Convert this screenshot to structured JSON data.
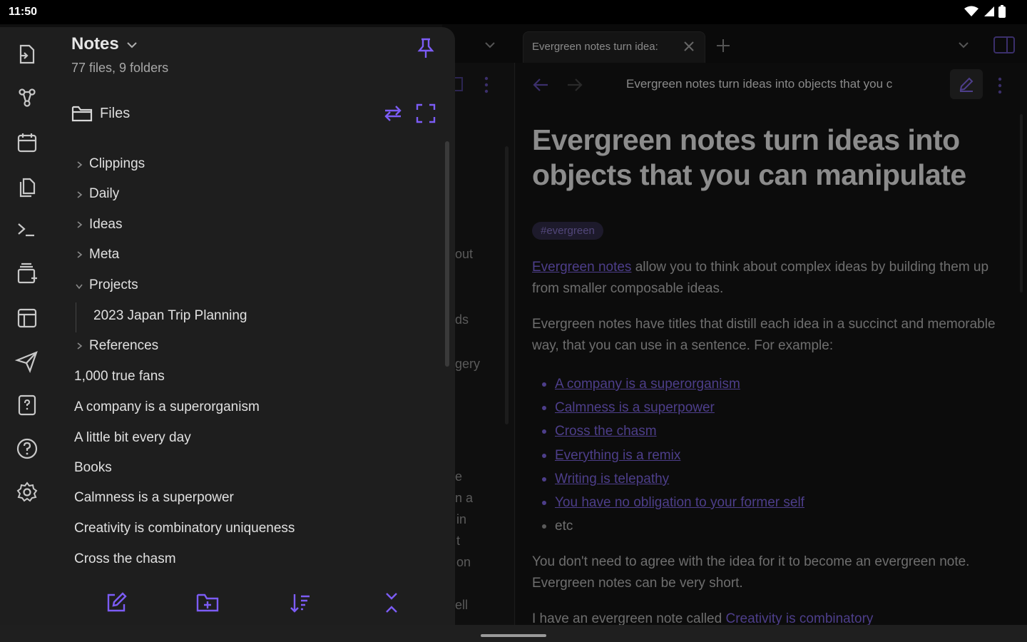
{
  "status_bar": {
    "time": "11:50"
  },
  "colors": {
    "accent": "#7c5cf6",
    "drawer_bg": "#1e1e1e",
    "editor_bg": "#0c0c0c"
  },
  "vault": {
    "name": "Notes",
    "stats": "77 files, 9 folders"
  },
  "files_panel": {
    "title": "Files"
  },
  "tree": [
    {
      "label": "Clippings",
      "type": "folder",
      "expanded": false
    },
    {
      "label": "Daily",
      "type": "folder",
      "expanded": false
    },
    {
      "label": "Ideas",
      "type": "folder",
      "expanded": false
    },
    {
      "label": "Meta",
      "type": "folder",
      "expanded": false
    },
    {
      "label": "Projects",
      "type": "folder",
      "expanded": true
    },
    {
      "label": "2023 Japan Trip Planning",
      "type": "file",
      "nested": true
    },
    {
      "label": "References",
      "type": "folder",
      "expanded": false
    },
    {
      "label": "1,000 true fans",
      "type": "file"
    },
    {
      "label": "A company is a superorganism",
      "type": "file"
    },
    {
      "label": "A little bit every day",
      "type": "file"
    },
    {
      "label": "Books",
      "type": "file"
    },
    {
      "label": "Calmness is a superpower",
      "type": "file"
    },
    {
      "label": "Creativity is combinatory uniqueness",
      "type": "file"
    },
    {
      "label": "Cross the chasm",
      "type": "file"
    }
  ],
  "ribbon_icons": [
    "open-quick-switcher-icon",
    "graph-view-icon",
    "daily-note-icon",
    "copy-icon",
    "command-palette-icon",
    "new-canvas-icon",
    "templates-icon",
    "publish-icon",
    "random-note-icon",
    "help-icon",
    "settings-icon"
  ],
  "bottom_actions": [
    "new-note-icon",
    "new-folder-icon",
    "sort-icon",
    "collapse-all-icon"
  ],
  "tab": {
    "title": "Evergreen notes turn idea:"
  },
  "breadcrumb": "Evergreen notes turn ideas into objects that you c",
  "note": {
    "title": "Evergreen notes turn ideas into objects that you can manipulate",
    "tag": "#evergreen",
    "p1_link": "Evergreen notes",
    "p1_rest": " allow you to think about complex ideas by building them up from smaller composable ideas.",
    "p2": "Evergreen notes have titles that distill each idea in a succinct and memorable way, that you can use in a sentence. For example:",
    "bullets": [
      "A company is a superorganism",
      "Calmness is a superpower",
      "Cross the chasm",
      "Everything is a remix",
      "Writing is telepathy",
      "You have no obligation to your former self",
      "etc"
    ],
    "p3": "You don't need to agree with the idea for it to become an evergreen note. Evergreen notes can be very short.",
    "p4_text": "I have an evergreen note called ",
    "p4_link": "Creativity is combinatory"
  },
  "mid_fragments": [
    "out",
    "ds",
    "gery",
    "e",
    "n a",
    "in",
    "t",
    "on",
    "ell"
  ]
}
